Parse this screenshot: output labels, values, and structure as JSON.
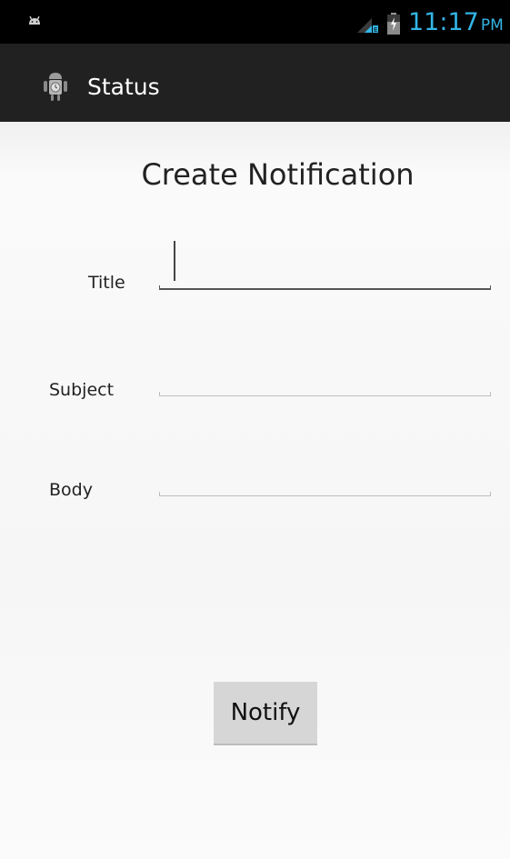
{
  "status_bar": {
    "time": "11:17",
    "ampm": "PM",
    "icons": [
      "android-notification-icon",
      "signal-icon",
      "battery-charging-icon"
    ],
    "time_color": "#33b5e5"
  },
  "action_bar": {
    "title": "Status",
    "icon": "app-icon",
    "background": "#212121"
  },
  "form": {
    "heading": "Create Notification",
    "fields": [
      {
        "label": "Title",
        "value": "",
        "focused": true
      },
      {
        "label": "Subject",
        "value": "",
        "focused": false
      },
      {
        "label": "Body",
        "value": "",
        "focused": false
      }
    ],
    "button_label": "Notify"
  }
}
